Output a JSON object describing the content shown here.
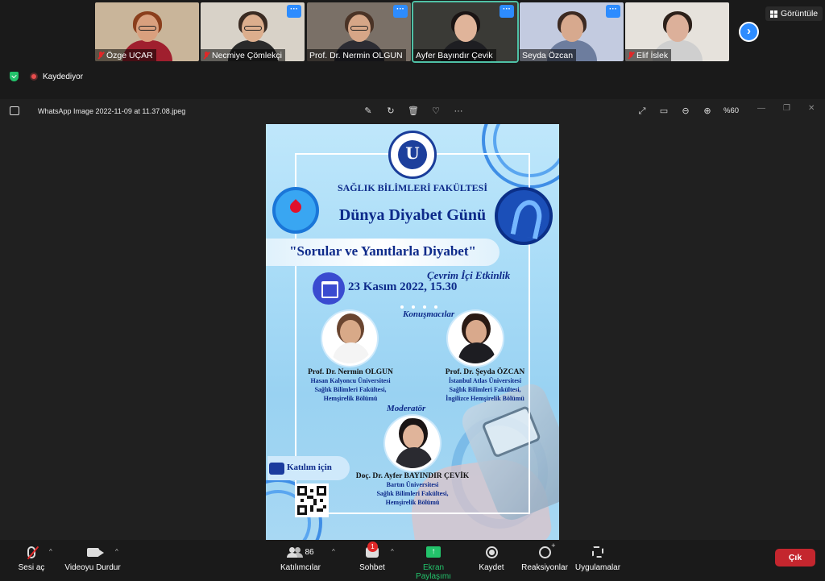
{
  "participants": [
    {
      "name": "Özge UÇAR",
      "muted": true,
      "bg": "#c9b59a",
      "skin": "#d9a07e",
      "hair": "#8a3e1c",
      "shirt": "#a01f2e",
      "more": false
    },
    {
      "name": "Necmiye Çömlekçi",
      "muted": true,
      "bg": "#d8d2c8",
      "skin": "#dcae8d",
      "hair": "#3a2b22",
      "shirt": "#2a2a2a",
      "more": true
    },
    {
      "name": "Prof. Dr. Nermin OLGUN",
      "muted": false,
      "bg": "#7a7067",
      "skin": "#d6a687",
      "hair": "#4a3326",
      "shirt": "#2c2c33",
      "more": true
    },
    {
      "name": "Ayfer Bayındır Çevik",
      "muted": false,
      "bg": "#3a3a36",
      "skin": "#e0b49a",
      "hair": "#1a1414",
      "shirt": "#1e1e22",
      "more": true
    },
    {
      "name": "Seyda Özcan",
      "muted": false,
      "bg": "#c3cbe0",
      "skin": "#d7a98e",
      "hair": "#3c2a22",
      "shirt": "#6d7d9e",
      "more": true
    },
    {
      "name": "Elif İslek",
      "muted": true,
      "bg": "#e6e2dc",
      "skin": "#dcb09a",
      "hair": "#2c201a",
      "shirt": "#cfcfcf",
      "more": false
    }
  ],
  "view_button": "Görüntüle",
  "recording_label": "Kaydediyor",
  "viewer": {
    "filename": "WhatsApp Image 2022-11-09 at 11.37.08.jpeg",
    "zoom": "%60"
  },
  "poster": {
    "faculty": "SAĞLIK BİLİMLERİ FAKÜLTESİ",
    "title": "Dünya Diyabet Günü",
    "subtitle": "\"Sorular ve Yanıtlarla Diyabet\"",
    "online": "Çevrim İçi Etkinlik",
    "date": "23 Kasım 2022, 15.30",
    "speakers_heading": "Konuşmacılar",
    "speaker1": {
      "name": "Prof. Dr. Nermin OLGUN",
      "line1": "Hasan Kalyoncu Üniversitesi",
      "line2": "Sağlık Bilimleri Fakültesi,",
      "line3": "Hemşirelik Bölümü"
    },
    "speaker2": {
      "name": "Prof. Dr. Şeyda ÖZCAN",
      "line1": "İstanbul Atlas Üniversitesi",
      "line2": "Sağlık Bilimleri Fakültesi,",
      "line3": "İngilizce Hemşirelik Bölümü"
    },
    "moderator_heading": "Moderatör",
    "moderator": {
      "name": "Doç. Dr. Ayfer BAYINDIR ÇEVİK",
      "line1": "Bartın Üniversitesi",
      "line2": "Sağlık Bilimleri Fakültesi,",
      "line3": "Hemşirelik Bölümü"
    },
    "join_label": "Katılım için"
  },
  "toolbar": {
    "unmute": "Sesi aç",
    "stop_video": "Videoyu Durdur",
    "participants": "Katılımcılar",
    "participant_count": "86",
    "chat": "Sohbet",
    "chat_badge": "1",
    "share": "Ekran Paylaşımı",
    "record": "Kaydet",
    "reactions": "Reaksiyonlar",
    "apps": "Uygulamalar",
    "leave": "Çık"
  }
}
